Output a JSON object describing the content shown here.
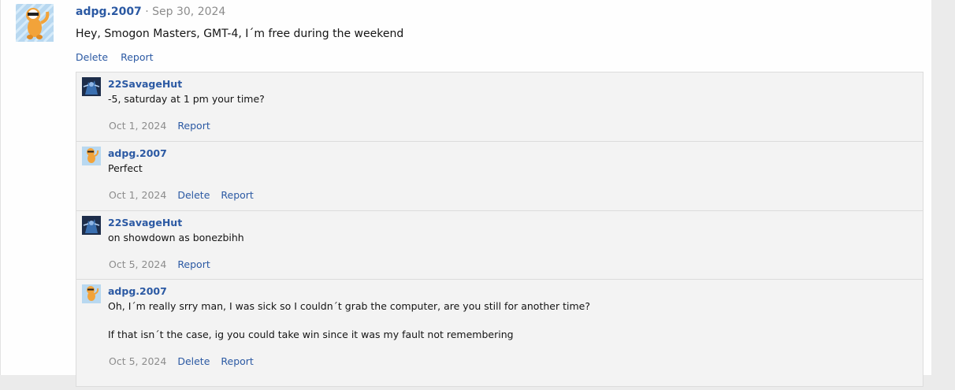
{
  "post": {
    "author": "adpg.2007",
    "separator": " · ",
    "date": "Sep 30, 2024",
    "body": "Hey, Smogon Masters, GMT-4, I´m free during the weekend",
    "actions": {
      "delete": "Delete",
      "report": "Report"
    }
  },
  "comments": [
    {
      "author": "22SavageHut",
      "avatar": "dark-creature-avatar",
      "lines": [
        "-5, saturday at 1 pm your time?"
      ],
      "date": "Oct 1, 2024",
      "report": "Report"
    },
    {
      "author": "adpg.2007",
      "avatar": "orange-pokemon-avatar",
      "lines": [
        "Perfect"
      ],
      "date": "Oct 1, 2024",
      "delete": "Delete",
      "report": "Report"
    },
    {
      "author": "22SavageHut",
      "avatar": "dark-creature-avatar",
      "lines": [
        "on showdown as bonezbihh"
      ],
      "date": "Oct 5, 2024",
      "report": "Report"
    },
    {
      "author": "adpg.2007",
      "avatar": "orange-pokemon-avatar",
      "lines": [
        "Oh, I´m really srry man, I was sick so I couldn´t grab the computer, are you still for another time?",
        "If that isn´t the case, ig you could take win since it was my fault not remembering"
      ],
      "date": "Oct 5, 2024",
      "delete": "Delete",
      "report": "Report"
    }
  ]
}
